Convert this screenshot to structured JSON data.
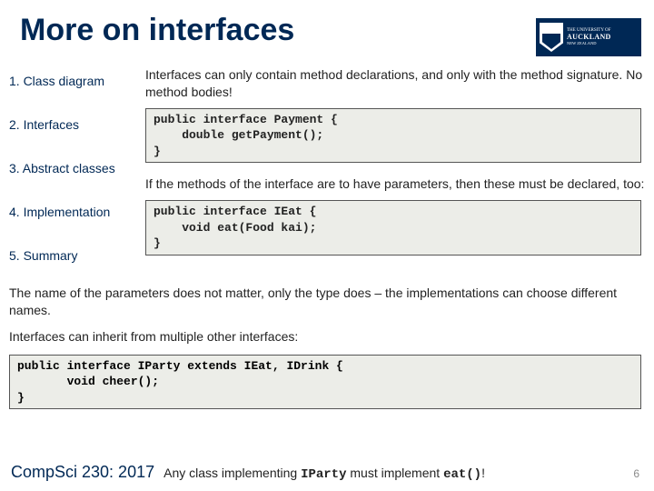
{
  "title": "More on interfaces",
  "logo": {
    "line1": "THE UNIVERSITY OF",
    "line2": "AUCKLAND",
    "line3": "Te Whare Wānanga o Tāmaki Makaurau",
    "line4": "NEW ZEALAND"
  },
  "sidebar": {
    "items": [
      "1. Class diagram",
      "2. Interfaces",
      "3. Abstract classes",
      "4. Implementation",
      "5. Summary"
    ]
  },
  "content": {
    "p1": "Interfaces can only contain method declarations, and only with the method signature. No method bodies!",
    "code1": "public interface Payment {\n    double getPayment();\n}",
    "p2": "If the methods of the interface are to have parameters, then these must be declared, too:",
    "code2": "public interface IEat {\n    void eat(Food kai);\n}",
    "p3": "The name of the parameters does not matter, only the type does – the implementations can choose different names.",
    "p4": "Interfaces can inherit from multiple other interfaces:",
    "code3": "public interface IParty extends IEat, IDrink {\n       void cheer();\n}",
    "p5a": "Any class implementing ",
    "p5b": "IParty",
    "p5c": " must implement ",
    "p5d": "eat()",
    "p5e": "!"
  },
  "footer": {
    "course": "CompSci 230: 2017",
    "page": "6"
  }
}
